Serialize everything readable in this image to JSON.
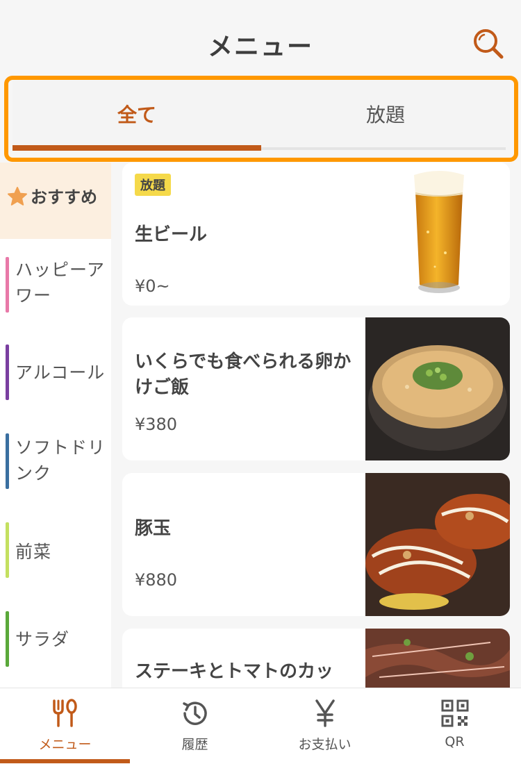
{
  "header": {
    "title": "メニュー",
    "search_icon": "search-icon"
  },
  "tabs": [
    {
      "label": "全て",
      "active": true
    },
    {
      "label": "放題",
      "active": false
    }
  ],
  "sidebar": {
    "recommended": {
      "label": "おすすめ",
      "icon": "star-icon",
      "color": "#f0a050"
    },
    "items": [
      {
        "label": "ハッピーアワー",
        "color": "#e879a8"
      },
      {
        "label": "アルコール",
        "color": "#7a3fa0"
      },
      {
        "label": "ソフトドリンク",
        "color": "#3a6fa0"
      },
      {
        "label": "前菜",
        "color": "#c4e060"
      },
      {
        "label": "サラダ",
        "color": "#5aa83a"
      }
    ]
  },
  "menu_items": [
    {
      "badge": "放題",
      "name": "生ビール",
      "price": "¥0~",
      "image": "beer-photo"
    },
    {
      "badge": "",
      "name": "いくらでも食べられる卵かけご飯",
      "price": "¥380",
      "image": "egg-rice-photo"
    },
    {
      "badge": "",
      "name": "豚玉",
      "price": "¥880",
      "image": "okonomiyaki-photo"
    },
    {
      "badge": "",
      "name": "ステーキとトマトのカッ",
      "price": "",
      "image": "steak-photo"
    }
  ],
  "bottom_nav": [
    {
      "label": "メニュー",
      "icon": "fork-spoon-icon",
      "active": true
    },
    {
      "label": "履歴",
      "icon": "history-icon",
      "active": false
    },
    {
      "label": "お支払い",
      "icon": "yen-icon",
      "active": false
    },
    {
      "label": "QR",
      "icon": "qr-code-icon",
      "active": false
    }
  ],
  "colors": {
    "accent": "#c15a19",
    "highlight_border": "#ff9800",
    "badge": "#f5d94a"
  }
}
